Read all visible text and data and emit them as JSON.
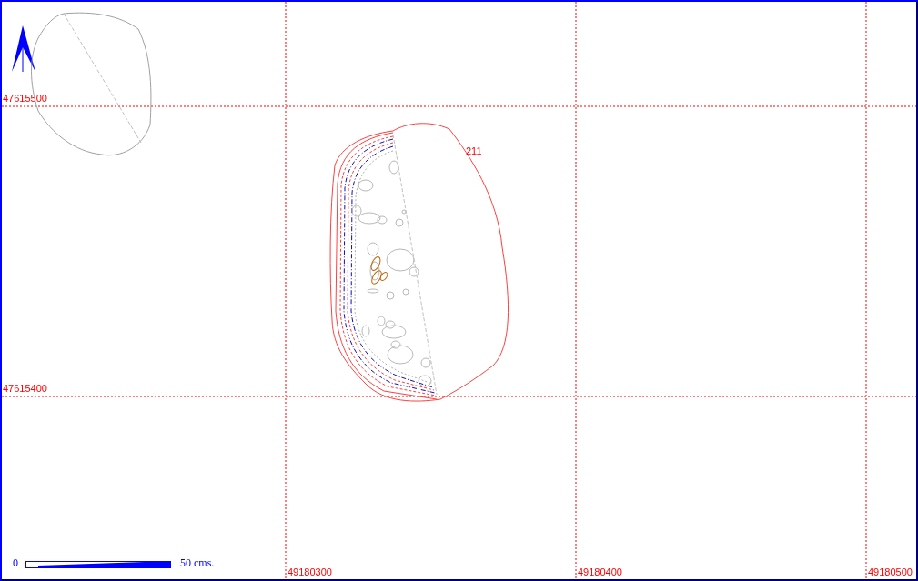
{
  "grid": {
    "northing_labels": [
      "47615500",
      "47615400"
    ],
    "easting_labels": [
      "49180300",
      "49180400",
      "49180500"
    ]
  },
  "feature": {
    "label": "211"
  },
  "scale_bar": {
    "start": "0",
    "end": "50 cms."
  }
}
